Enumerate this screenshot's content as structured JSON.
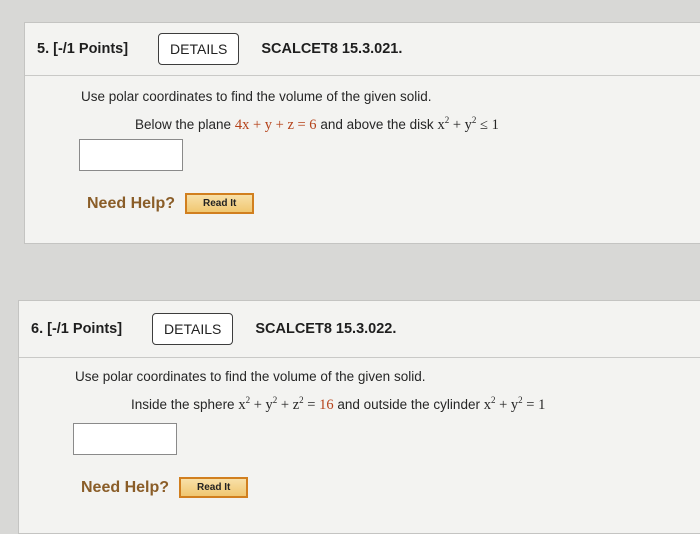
{
  "questions": [
    {
      "points": "5. [-/1 Points]",
      "details_label": "DETAILS",
      "source": "SCALCET8 15.3.021.",
      "prompt": "Use polar coordinates to find the volume of the given solid.",
      "sub": {
        "pre": "Below the plane",
        "expr": "4x + y + z = 6",
        "mid": "and above the disk",
        "cond_base": "x",
        "cond_y": " + y",
        "cond_tail": " ≤ 1",
        "exp": "2"
      },
      "answer_value": "",
      "need_help": "Need Help?",
      "read_it": "Read It"
    },
    {
      "points": "6. [-/1 Points]",
      "details_label": "DETAILS",
      "source": "SCALCET8 15.3.022.",
      "prompt": "Use polar coordinates to find the volume of the given solid.",
      "sub": {
        "pre": "Inside the sphere",
        "expr_x": "x",
        "expr_y": " + y",
        "expr_z": " + z",
        "expr_eq": " = ",
        "expr_val": "16",
        "mid": "and outside the cylinder",
        "cyl_x": "x",
        "cyl_y": " + y",
        "cyl_tail": " = 1",
        "exp": "2"
      },
      "answer_value": "",
      "need_help": "Need Help?",
      "read_it": "Read It"
    }
  ]
}
